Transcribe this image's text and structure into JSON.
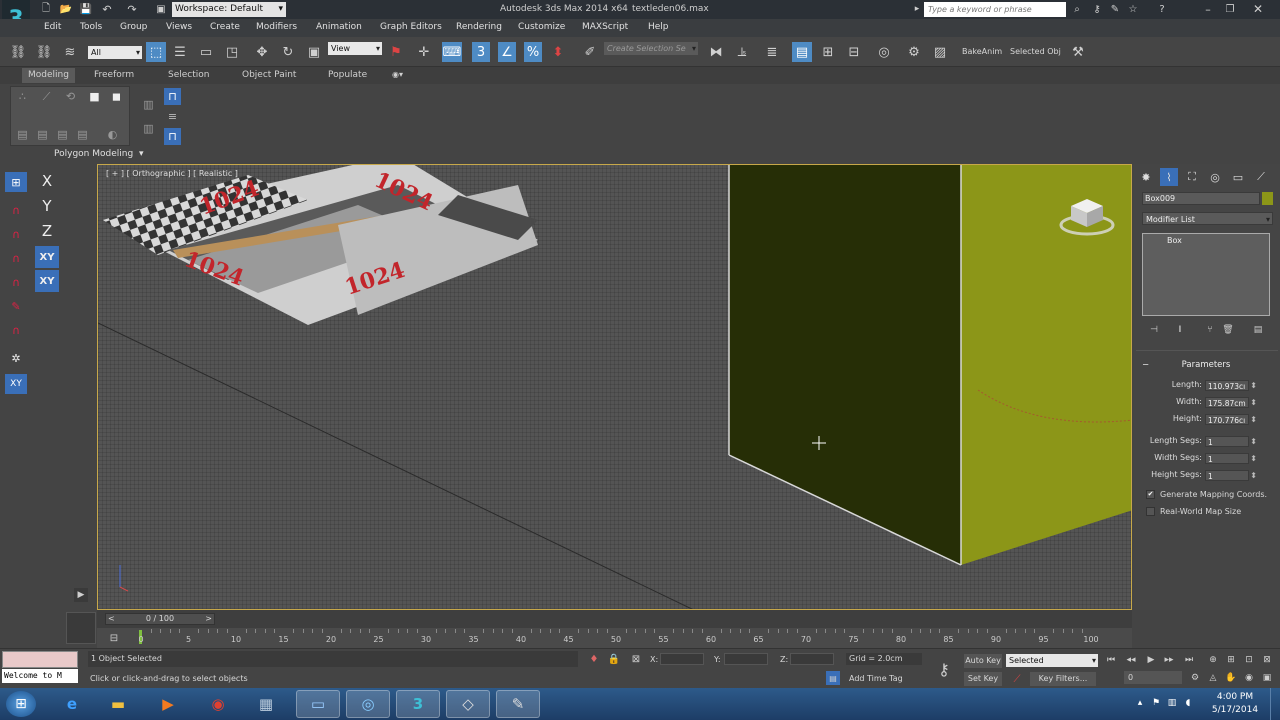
{
  "titlebar": {
    "workspace": "Workspace: Default",
    "app_title": "Autodesk 3ds Max 2014 x64",
    "file_name": "textleden06.max",
    "search_placeholder": "Type a keyword or phrase"
  },
  "menu": [
    "Edit",
    "Tools",
    "Group",
    "Views",
    "Create",
    "Modifiers",
    "Animation",
    "Graph Editors",
    "Rendering",
    "Customize",
    "MAXScript",
    "Help"
  ],
  "toolbar": {
    "selection_filter": "All",
    "ref_coord": "View",
    "named_selection_placeholder": "Create Selection Se",
    "bake_anim": "BakeAnim",
    "selected_obj": "Selected Obj"
  },
  "ribbon": {
    "tabs": [
      "Modeling",
      "Freeform",
      "Selection",
      "Object Paint",
      "Populate"
    ],
    "panel_label": "Polygon Modeling"
  },
  "viewport": {
    "label": "[ + ] [ Orthographic ] [ Realistic ]",
    "texture_text": "1024"
  },
  "command_panel": {
    "object_name": "Box009",
    "modifier_list": "Modifier List",
    "stack_item": "Box",
    "rollout_title": "Parameters",
    "params": [
      {
        "label": "Length:",
        "value": "110.973cı"
      },
      {
        "label": "Width:",
        "value": "175.87cm"
      },
      {
        "label": "Height:",
        "value": "170.776cı"
      },
      {
        "label": "Length Segs:",
        "value": "1"
      },
      {
        "label": "Width Segs:",
        "value": "1"
      },
      {
        "label": "Height Segs:",
        "value": "1"
      }
    ],
    "check_mapping": "Generate Mapping Coords.",
    "check_realworld": "Real-World Map Size"
  },
  "timeline": {
    "slider_label": "0 / 100",
    "ticks": [
      "0",
      "5",
      "10",
      "15",
      "20",
      "25",
      "30",
      "35",
      "40",
      "45",
      "50",
      "55",
      "60",
      "65",
      "70",
      "75",
      "80",
      "85",
      "90",
      "95",
      "100"
    ]
  },
  "status": {
    "maxscript_listener": "Welcome to M",
    "selection_count": "1 Object Selected",
    "prompt": "Click or click-and-drag to select objects",
    "x_label": "X:",
    "y_label": "Y:",
    "z_label": "Z:",
    "grid": "Grid = 2.0cm",
    "add_time_tag": "Add Time Tag",
    "auto_key": "Auto Key",
    "set_key": "Set Key",
    "key_mode": "Selected",
    "key_filters": "Key Filters...",
    "frame": "0"
  },
  "taskbar": {
    "time": "4:00 PM",
    "date": "5/17/2014"
  },
  "colors": {
    "viewport_border": "#c7a84a",
    "selection_blue": "#3a6fb8",
    "box_dark_face": "#262e06",
    "box_light_face": "#8c9618"
  }
}
